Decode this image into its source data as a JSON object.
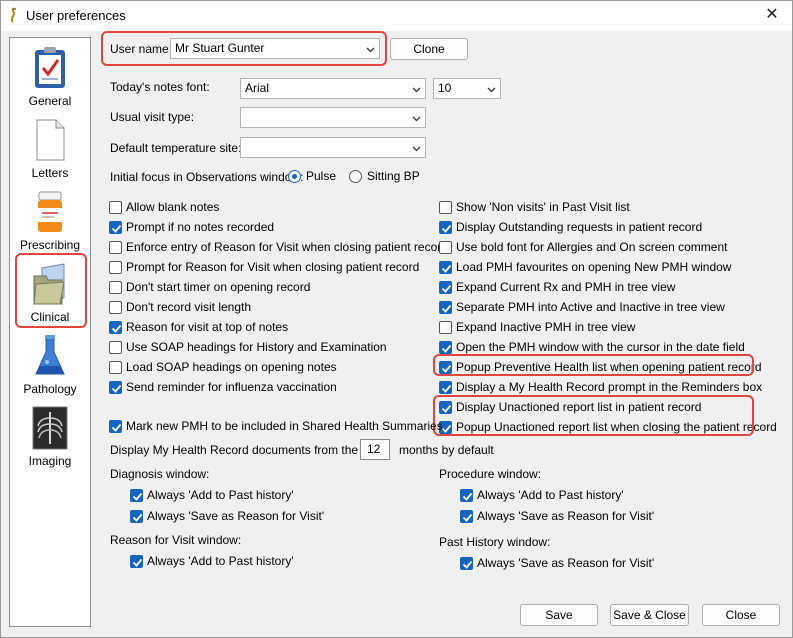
{
  "window": {
    "title": "User preferences"
  },
  "sidebar": {
    "items": [
      {
        "label": "General",
        "icon": "clipboard-check-icon"
      },
      {
        "label": "Letters",
        "icon": "document-icon"
      },
      {
        "label": "Prescribing",
        "icon": "pill-bottle-icon"
      },
      {
        "label": "Clinical",
        "icon": "folder-icon"
      },
      {
        "label": "Pathology",
        "icon": "flask-icon"
      },
      {
        "label": "Imaging",
        "icon": "xray-icon"
      }
    ],
    "selected": "Clinical"
  },
  "user": {
    "label": "User name:",
    "value": "Mr Stuart Gunter",
    "clone_label": "Clone"
  },
  "font": {
    "label": "Today's notes font:",
    "family": "Arial",
    "size": "10"
  },
  "visit_type": {
    "label": "Usual visit type:",
    "value": ""
  },
  "temperature": {
    "label": "Default temperature site:",
    "value": ""
  },
  "focus": {
    "label": "Initial focus in Observations window:",
    "options": [
      "Pulse",
      "Sitting BP"
    ],
    "selected": "Pulse"
  },
  "left_checks": [
    {
      "label": "Allow blank notes",
      "checked": false
    },
    {
      "label": "Prompt if no notes recorded",
      "checked": true
    },
    {
      "label": "Enforce entry of Reason for Visit when closing patient record",
      "checked": false
    },
    {
      "label": "Prompt for Reason for Visit when closing patient record",
      "checked": false
    },
    {
      "label": "Don't start timer on opening record",
      "checked": false
    },
    {
      "label": "Don't record visit length",
      "checked": false
    },
    {
      "label": "Reason for visit at top of notes",
      "checked": true
    },
    {
      "label": "Use SOAP headings for History and Examination",
      "checked": false
    },
    {
      "label": "Load SOAP headings on opening notes",
      "checked": false
    },
    {
      "label": "Send reminder for influenza vaccination",
      "checked": true
    }
  ],
  "right_checks": [
    {
      "label": "Show 'Non visits' in Past Visit list",
      "checked": false
    },
    {
      "label": "Display Outstanding requests in patient record",
      "checked": true
    },
    {
      "label": "Use bold font for Allergies and On screen comment",
      "checked": false
    },
    {
      "label": "Load PMH favourites on opening New PMH window",
      "checked": true
    },
    {
      "label": "Expand Current Rx and PMH in tree view",
      "checked": true
    },
    {
      "label": "Separate PMH into Active and Inactive in tree view",
      "checked": true
    },
    {
      "label": "Expand Inactive PMH in tree view",
      "checked": false
    },
    {
      "label": "Open the PMH window with the cursor in the date field",
      "checked": true
    },
    {
      "label": "Popup Preventive Health list when opening patient record",
      "checked": true
    },
    {
      "label": "Display a My Health Record prompt in the Reminders box",
      "checked": true
    },
    {
      "label": "Display Unactioned report list in patient record",
      "checked": true
    },
    {
      "label": "Popup Unactioned report list when closing the patient record",
      "checked": true
    }
  ],
  "shared_health": {
    "label": "Mark new PMH to be included in Shared Health Summaries",
    "checked": true
  },
  "mhr_docs": {
    "label_before": "Display My Health Record documents from the last:",
    "value": "12",
    "label_after": "months by default"
  },
  "diagnosis": {
    "title": "Diagnosis window:",
    "checks": [
      {
        "label": "Always 'Add to Past history'",
        "checked": true
      },
      {
        "label": "Always 'Save as Reason for Visit'",
        "checked": true
      }
    ]
  },
  "procedure": {
    "title": "Procedure window:",
    "checks": [
      {
        "label": "Always 'Add to Past history'",
        "checked": true
      },
      {
        "label": "Always 'Save as Reason for Visit'",
        "checked": true
      }
    ]
  },
  "reason_window": {
    "title": "Reason for Visit window:",
    "checks": [
      {
        "label": "Always 'Add to Past history'",
        "checked": true
      }
    ]
  },
  "past_history_window": {
    "title": "Past History window:",
    "checks": [
      {
        "label": "Always 'Save as Reason for Visit'",
        "checked": true
      }
    ]
  },
  "footer": {
    "save": "Save",
    "save_close": "Save & Close",
    "close": "Close"
  },
  "colors": {
    "accent": "#1565c0",
    "highlight": "#e0453e"
  }
}
